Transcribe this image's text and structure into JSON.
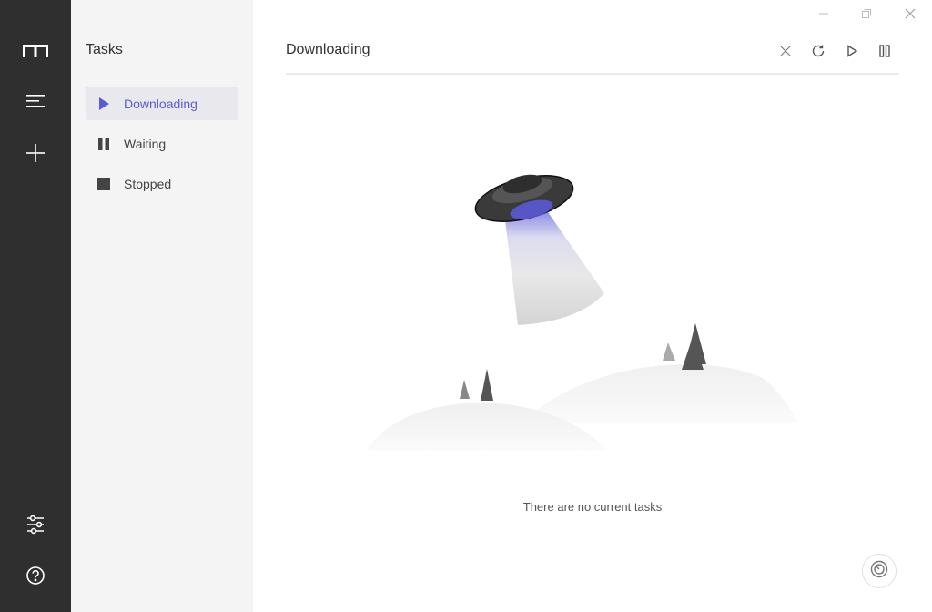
{
  "sidebar": {
    "title": "Tasks",
    "items": [
      {
        "label": "Downloading",
        "icon": "play-icon",
        "active": true
      },
      {
        "label": "Waiting",
        "icon": "pause-icon",
        "active": false
      },
      {
        "label": "Stopped",
        "icon": "stop-icon",
        "active": false
      }
    ]
  },
  "rail": {
    "icons": [
      "app-logo-icon",
      "menu-icon",
      "add-icon",
      "settings-sliders-icon",
      "help-icon"
    ]
  },
  "main": {
    "title": "Downloading",
    "toolbar": [
      "clear-icon",
      "refresh-icon",
      "resume-all-icon",
      "pause-all-icon"
    ],
    "empty_message": "There are no current tasks"
  },
  "colors": {
    "rail_bg": "#2f2f2f",
    "sidebar_bg": "#f4f4f5",
    "accent": "#5b5bd6"
  }
}
